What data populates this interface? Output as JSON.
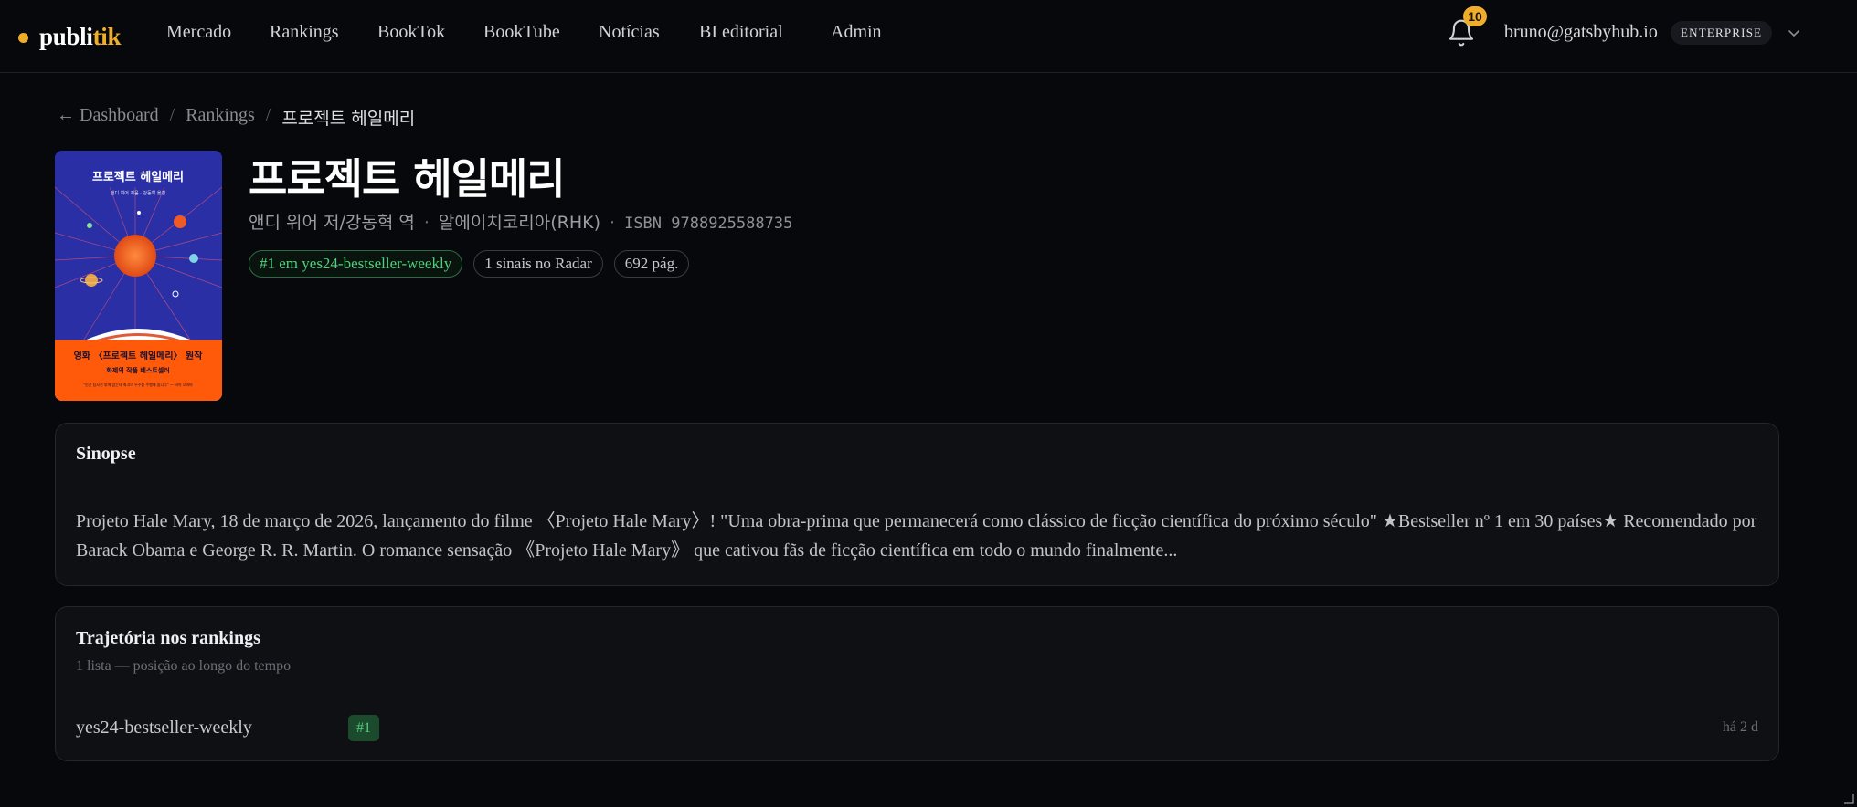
{
  "app": {
    "logo_part1": "publi",
    "logo_part2": "tik"
  },
  "nav": [
    {
      "label": "Mercado"
    },
    {
      "label": "Rankings"
    },
    {
      "label": "BookTok"
    },
    {
      "label": "BookTube"
    },
    {
      "label": "Notícias"
    },
    {
      "label": "BI editorial"
    },
    {
      "label": "Admin"
    }
  ],
  "notifications": {
    "count": "10",
    "icon": "bell-icon"
  },
  "user": {
    "email": "bruno@gatsbyhub.io",
    "plan": "ENTERPRISE"
  },
  "breadcrumb": {
    "back": "← Dashboard",
    "sep": "/",
    "level2": "Rankings",
    "current": "프로젝트 헤일메리"
  },
  "cover": {
    "title": "프로젝트 헤일메리",
    "author_line": "앤디 위어 지음 · 강동혁 옮김",
    "banner_main": "영화 〈프로젝트 헤일메리〉 원작",
    "banner_sub": "화제의 작품 베스트셀러",
    "banner_quote": "\"인간 탐사선 밖에 없는데 최고의 우주를 수행해 줍니다\" — 버락 오바마",
    "colors": {
      "sky": "#2a2fa5",
      "sun": "#f25a1b",
      "banner": "#ff5a0a"
    }
  },
  "book": {
    "title": "프로젝트 헤일메리",
    "authors": "앤디 위어 저/강동혁 역",
    "publisher": "알에이치코리아(RHK)",
    "isbn": "ISBN 9788925588735",
    "chips": {
      "rank": "#1 em yes24-bestseller-weekly",
      "signals": "1 sinais no Radar",
      "pages": "692 pág."
    }
  },
  "synopsis": {
    "title": "Sinopse",
    "text": "Projeto Hale Mary, 18 de março de 2026, lançamento do filme 〈Projeto Hale Mary〉! \"Uma obra-prima que permanecerá como clássico de ficção científica do próximo século\" ★Bestseller nº 1 em 30 países★ Recomendado por Barack Obama e George R. R. Martin. O romance sensação 《Projeto Hale Mary》 que cativou fãs de ficção científica em todo o mundo finalmente..."
  },
  "trajectory": {
    "title": "Trajetória nos rankings",
    "subtitle": "1 lista — posição ao longo do tempo",
    "rows": [
      {
        "list": "yes24-bestseller-weekly",
        "rank": "#1",
        "ago": "há 2 d"
      }
    ]
  },
  "colors": {
    "accent": "#f0ad2a",
    "success": "#4fd07e",
    "background": "#07080b"
  }
}
